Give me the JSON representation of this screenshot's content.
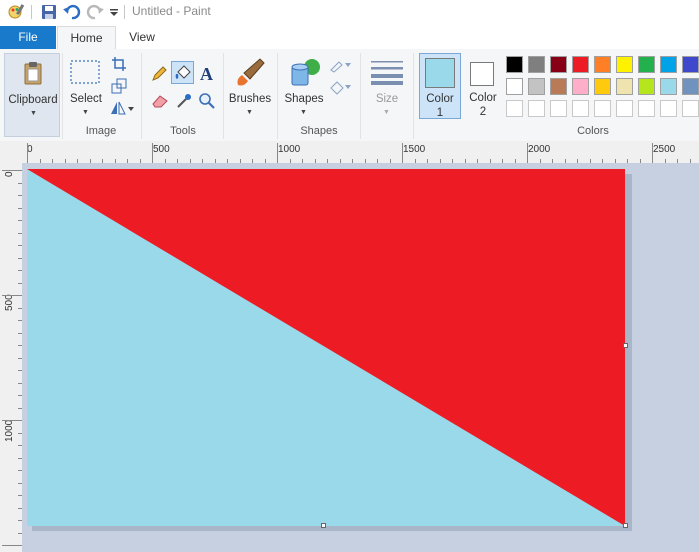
{
  "window": {
    "title": "Untitled - Paint"
  },
  "tabs": {
    "file": "File",
    "home": "Home",
    "view": "View"
  },
  "ribbon": {
    "clipboard": {
      "label": "Clipboard"
    },
    "image": {
      "select_label": "Select",
      "group_label": "Image"
    },
    "tools": {
      "group_label": "Tools"
    },
    "brushes": {
      "label": "Brushes"
    },
    "shapes": {
      "label": "Shapes",
      "group_label": "Shapes"
    },
    "size": {
      "label": "Size"
    },
    "color1": {
      "label_line1": "Color",
      "label_line2": "1",
      "color": "#99d9ea"
    },
    "color2": {
      "label_line1": "Color",
      "label_line2": "2",
      "color": "#ffffff"
    },
    "colors": {
      "group_label": "Colors",
      "row1": [
        "#000000",
        "#7f7f7f",
        "#880015",
        "#ed1c24",
        "#ff7f27",
        "#fff200",
        "#22b14c",
        "#00a2e8",
        "#3f48cc"
      ],
      "row2": [
        "#ffffff",
        "#c3c3c3",
        "#b97a57",
        "#ffaec9",
        "#ffc90e",
        "#efe4b0",
        "#b5e61d",
        "#99d9ea",
        "#7092be"
      ]
    }
  },
  "ruler": {
    "h_labels": [
      "0",
      "500",
      "1000",
      "1500",
      "2000",
      "2500"
    ],
    "v_labels": [
      "0",
      "500",
      "1000"
    ]
  },
  "canvas": {
    "fill_top": "#ed1c24",
    "fill_bottom": "#99d9ea"
  }
}
